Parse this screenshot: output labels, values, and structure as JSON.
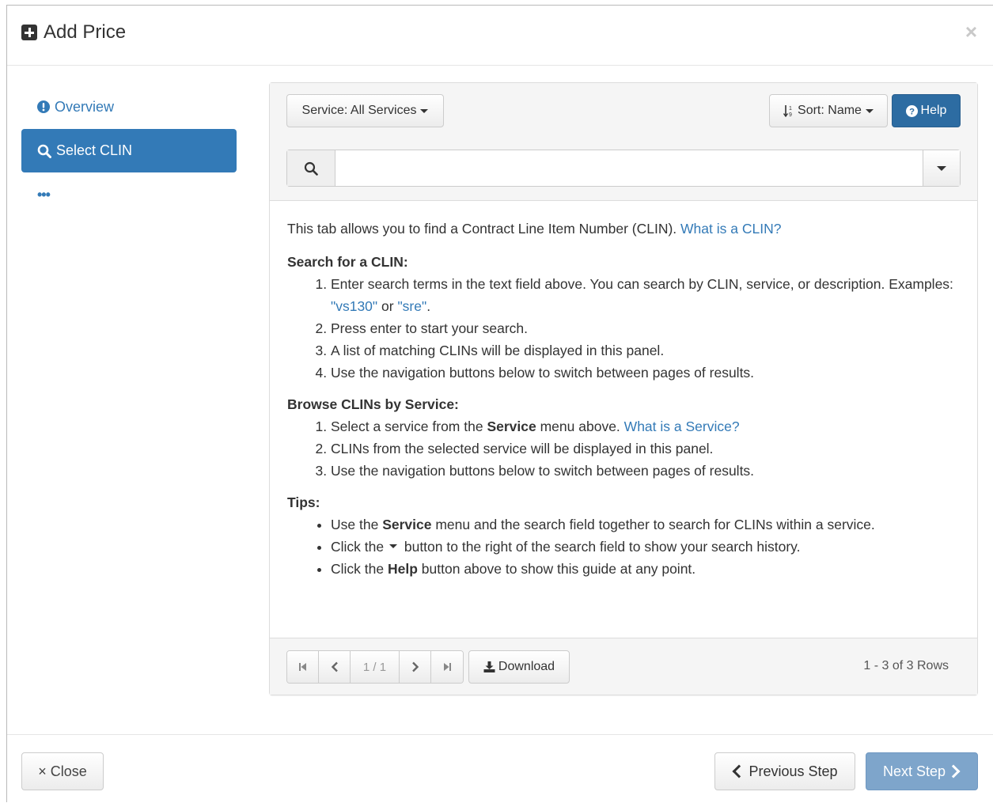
{
  "modal": {
    "title": "Add Price",
    "close_symbol": "×"
  },
  "sidebar": {
    "items": [
      {
        "label": "Overview",
        "icon": "exclamation-circle-icon"
      },
      {
        "label": "Select CLIN",
        "icon": "search-icon",
        "active": true
      }
    ],
    "more": "•••"
  },
  "toolbar": {
    "service_label": "Service: All Services",
    "sort_label": "Sort: Name",
    "help_label": "Help"
  },
  "search": {
    "placeholder": "",
    "value": ""
  },
  "help": {
    "intro": "This tab allows you to find a Contract Line Item Number (CLIN).",
    "intro_link": "What is a CLIN?",
    "search_heading": "Search for a CLIN:",
    "search_steps": {
      "s1_a": "Enter search terms in the text field above. You can search by CLIN, service, or description. Examples:",
      "s1_ex1": "\"vs130\"",
      "s1_or": "or",
      "s1_ex2": "\"sre\"",
      "s1_end": ".",
      "s2": "Press enter to start your search.",
      "s3": "A list of matching CLINs will be displayed in this panel.",
      "s4": "Use the navigation buttons below to switch between pages of results."
    },
    "browse_heading": "Browse CLINs by Service:",
    "browse_steps": {
      "b1_a": "Select a service from the",
      "b1_bold": "Service",
      "b1_b": "menu above.",
      "b1_link": "What is a Service?",
      "b2": "CLINs from the selected service will be displayed in this panel.",
      "b3": "Use the navigation buttons below to switch between pages of results."
    },
    "tips_heading": "Tips:",
    "tips": {
      "t1_a": "Use the",
      "t1_bold": "Service",
      "t1_b": "menu and the search field together to search for CLINs within a service.",
      "t2_a": "Click the",
      "t2_b": "button to the right of the search field to show your search history.",
      "t3_a": "Click the",
      "t3_bold": "Help",
      "t3_b": "button above to show this guide at any point."
    }
  },
  "pager": {
    "page_info": "1 / 1",
    "download_label": "Download",
    "rows_info": "1 - 3 of 3 Rows"
  },
  "footer": {
    "close_label": "× Close",
    "prev_label": "Previous Step",
    "next_label": "Next Step"
  },
  "colors": {
    "primary": "#337ab7",
    "help_button": "#2d6ca2",
    "next_button_disabled": "#7ea5cb"
  }
}
